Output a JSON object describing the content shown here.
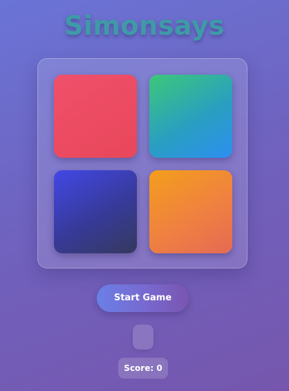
{
  "game": {
    "title": "Simonsays"
  },
  "pads": {
    "red": {
      "color": "#e8475a"
    },
    "green": {
      "color": "#2c8ff0"
    },
    "blue": {
      "color": "#3a3fa8"
    },
    "orange": {
      "color": "#ef8140"
    }
  },
  "controls": {
    "start_label": "Start Game",
    "level_value": "",
    "score_label": "Score: 0"
  },
  "colors": {
    "title": "#3f9aa8",
    "background": "#6f63c0"
  }
}
